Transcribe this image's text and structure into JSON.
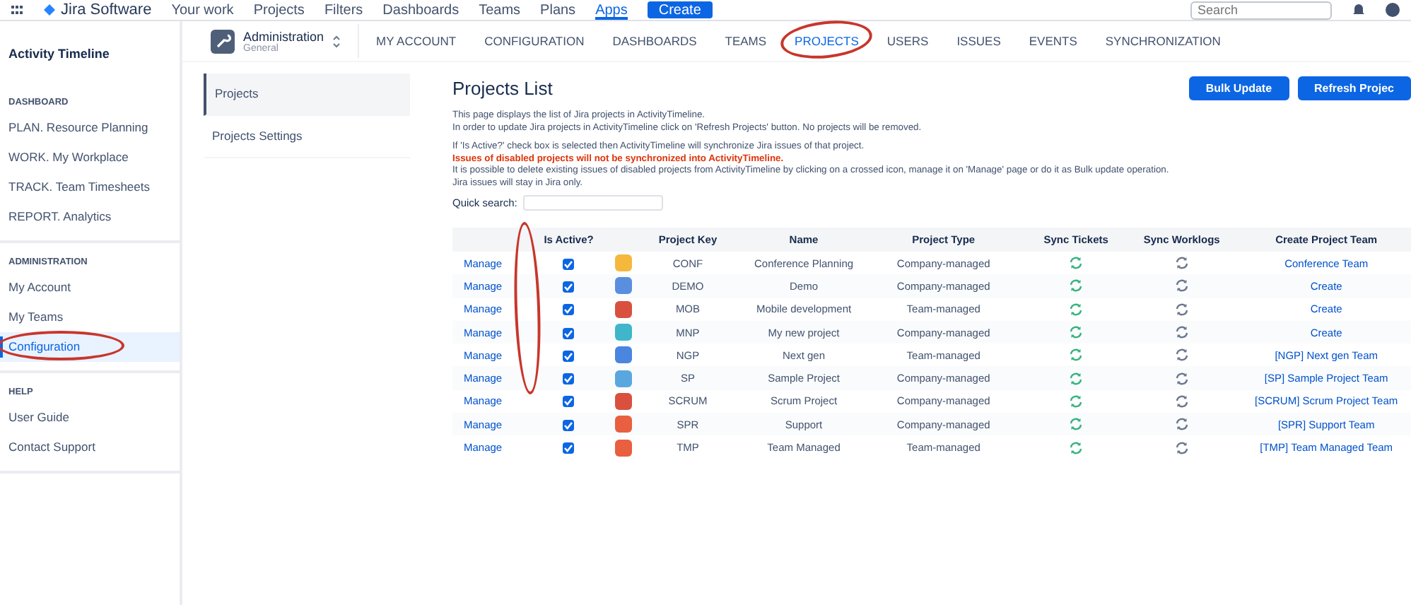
{
  "topbar": {
    "product": "Jira Software",
    "items": [
      {
        "label": "Your work",
        "selected": false
      },
      {
        "label": "Projects",
        "selected": false
      },
      {
        "label": "Filters",
        "selected": false
      },
      {
        "label": "Dashboards",
        "selected": false
      },
      {
        "label": "Teams",
        "selected": false
      },
      {
        "label": "Plans",
        "selected": false
      },
      {
        "label": "Apps",
        "selected": true
      }
    ],
    "create": "Create",
    "search": {
      "placeholder": "Search"
    }
  },
  "sidebar": {
    "title": "Activity Timeline",
    "sections": [
      {
        "heading": "DASHBOARD",
        "items": [
          {
            "label": "PLAN. Resource Planning",
            "selected": false,
            "circled": false
          },
          {
            "label": "WORK. My Workplace",
            "selected": false,
            "circled": false
          },
          {
            "label": "TRACK. Team Timesheets",
            "selected": false,
            "circled": false
          },
          {
            "label": "REPORT. Analytics",
            "selected": false,
            "circled": false
          }
        ]
      },
      {
        "heading": "ADMINISTRATION",
        "items": [
          {
            "label": "My Account",
            "selected": false,
            "circled": false
          },
          {
            "label": "My Teams",
            "selected": false,
            "circled": false
          },
          {
            "label": "Configuration",
            "selected": true,
            "circled": true
          }
        ]
      },
      {
        "heading": "HELP",
        "items": [
          {
            "label": "User Guide",
            "selected": false,
            "circled": false
          },
          {
            "label": "Contact Support",
            "selected": false,
            "circled": false
          }
        ]
      }
    ]
  },
  "admin": {
    "title": "Administration",
    "subtitle": "General"
  },
  "tabs": [
    {
      "label": "MY ACCOUNT",
      "selected": false,
      "circled": false
    },
    {
      "label": "CONFIGURATION",
      "selected": false,
      "circled": false
    },
    {
      "label": "DASHBOARDS",
      "selected": false,
      "circled": false
    },
    {
      "label": "TEAMS",
      "selected": false,
      "circled": false
    },
    {
      "label": "PROJECTS",
      "selected": true,
      "circled": true
    },
    {
      "label": "USERS",
      "selected": false,
      "circled": false
    },
    {
      "label": "ISSUES",
      "selected": false,
      "circled": false
    },
    {
      "label": "EVENTS",
      "selected": false,
      "circled": false
    },
    {
      "label": "SYNCHRONIZATION",
      "selected": false,
      "circled": false
    }
  ],
  "subnav": [
    {
      "label": "Projects",
      "selected": true
    },
    {
      "label": "Projects Settings",
      "selected": false
    }
  ],
  "page": {
    "title": "Projects List",
    "buttons": [
      "Bulk Update",
      "Refresh Projec"
    ],
    "info": [
      {
        "kind": "plain",
        "text": "This page displays the list of Jira projects in ActivityTimeline."
      },
      {
        "kind": "plain",
        "text": "In order to update Jira projects in ActivityTimeline click on 'Refresh Projects' button. No projects will be removed."
      },
      {
        "kind": "gap"
      },
      {
        "kind": "plain",
        "text": "If 'Is Active?' check box is selected then ActivityTimeline will synchronize Jira issues of that project."
      },
      {
        "kind": "warning",
        "text": "Issues of disabled projects will not be synchronized into ActivityTimeline."
      },
      {
        "kind": "plain",
        "text": "It is possible to delete existing issues of disabled projects from ActivityTimeline by clicking on a crossed icon, manage it on 'Manage' page or do it as Bulk update operation."
      },
      {
        "kind": "plain",
        "text": "Jira issues will stay in Jira only."
      }
    ],
    "quick_search": {
      "label": "Quick search:"
    }
  },
  "table": {
    "columns": [
      {
        "circled": false
      },
      {
        "label": "Is Active?",
        "circled": true
      },
      {
        "circled": false
      },
      {
        "label": "Project Key",
        "circled": false
      },
      {
        "label": "Name",
        "circled": false
      },
      {
        "label": "Project Type",
        "circled": false
      },
      {
        "label": "Sync Tickets",
        "circled": false
      },
      {
        "label": "Sync Worklogs",
        "circled": false
      },
      {
        "label": "Create Project Team",
        "circled": false
      }
    ],
    "rows": [
      {
        "manage": "Manage",
        "active": true,
        "color": "#f5b83d",
        "key": "CONF",
        "name": "Conference Planning",
        "type": "Company-managed",
        "team": "Conference Team"
      },
      {
        "manage": "Manage",
        "active": true,
        "color": "#5a8fe0",
        "key": "DEMO",
        "name": "Demo",
        "type": "Company-managed",
        "team": "Create"
      },
      {
        "manage": "Manage",
        "active": true,
        "color": "#d9503f",
        "key": "MOB",
        "name": "Mobile development",
        "type": "Team-managed",
        "team": "Create"
      },
      {
        "manage": "Manage",
        "active": true,
        "color": "#3fb6c9",
        "key": "MNP",
        "name": "My new project",
        "type": "Company-managed",
        "team": "Create"
      },
      {
        "manage": "Manage",
        "active": true,
        "color": "#4a86e0",
        "key": "NGP",
        "name": "Next gen",
        "type": "Team-managed",
        "team": "[NGP] Next gen Team"
      },
      {
        "manage": "Manage",
        "active": true,
        "color": "#5aa7e0",
        "key": "SP",
        "name": "Sample Project",
        "type": "Company-managed",
        "team": "[SP] Sample Project Team"
      },
      {
        "manage": "Manage",
        "active": true,
        "color": "#d9503f",
        "key": "SCRUM",
        "name": "Scrum Project",
        "type": "Company-managed",
        "team": "[SCRUM] Scrum Project Team"
      },
      {
        "manage": "Manage",
        "active": true,
        "color": "#e8603f",
        "key": "SPR",
        "name": "Support",
        "type": "Company-managed",
        "team": "[SPR] Support Team"
      },
      {
        "manage": "Manage",
        "active": true,
        "color": "#e8603f",
        "key": "TMP",
        "name": "Team Managed",
        "type": "Team-managed",
        "team": "[TMP] Team Managed Team"
      }
    ]
  }
}
